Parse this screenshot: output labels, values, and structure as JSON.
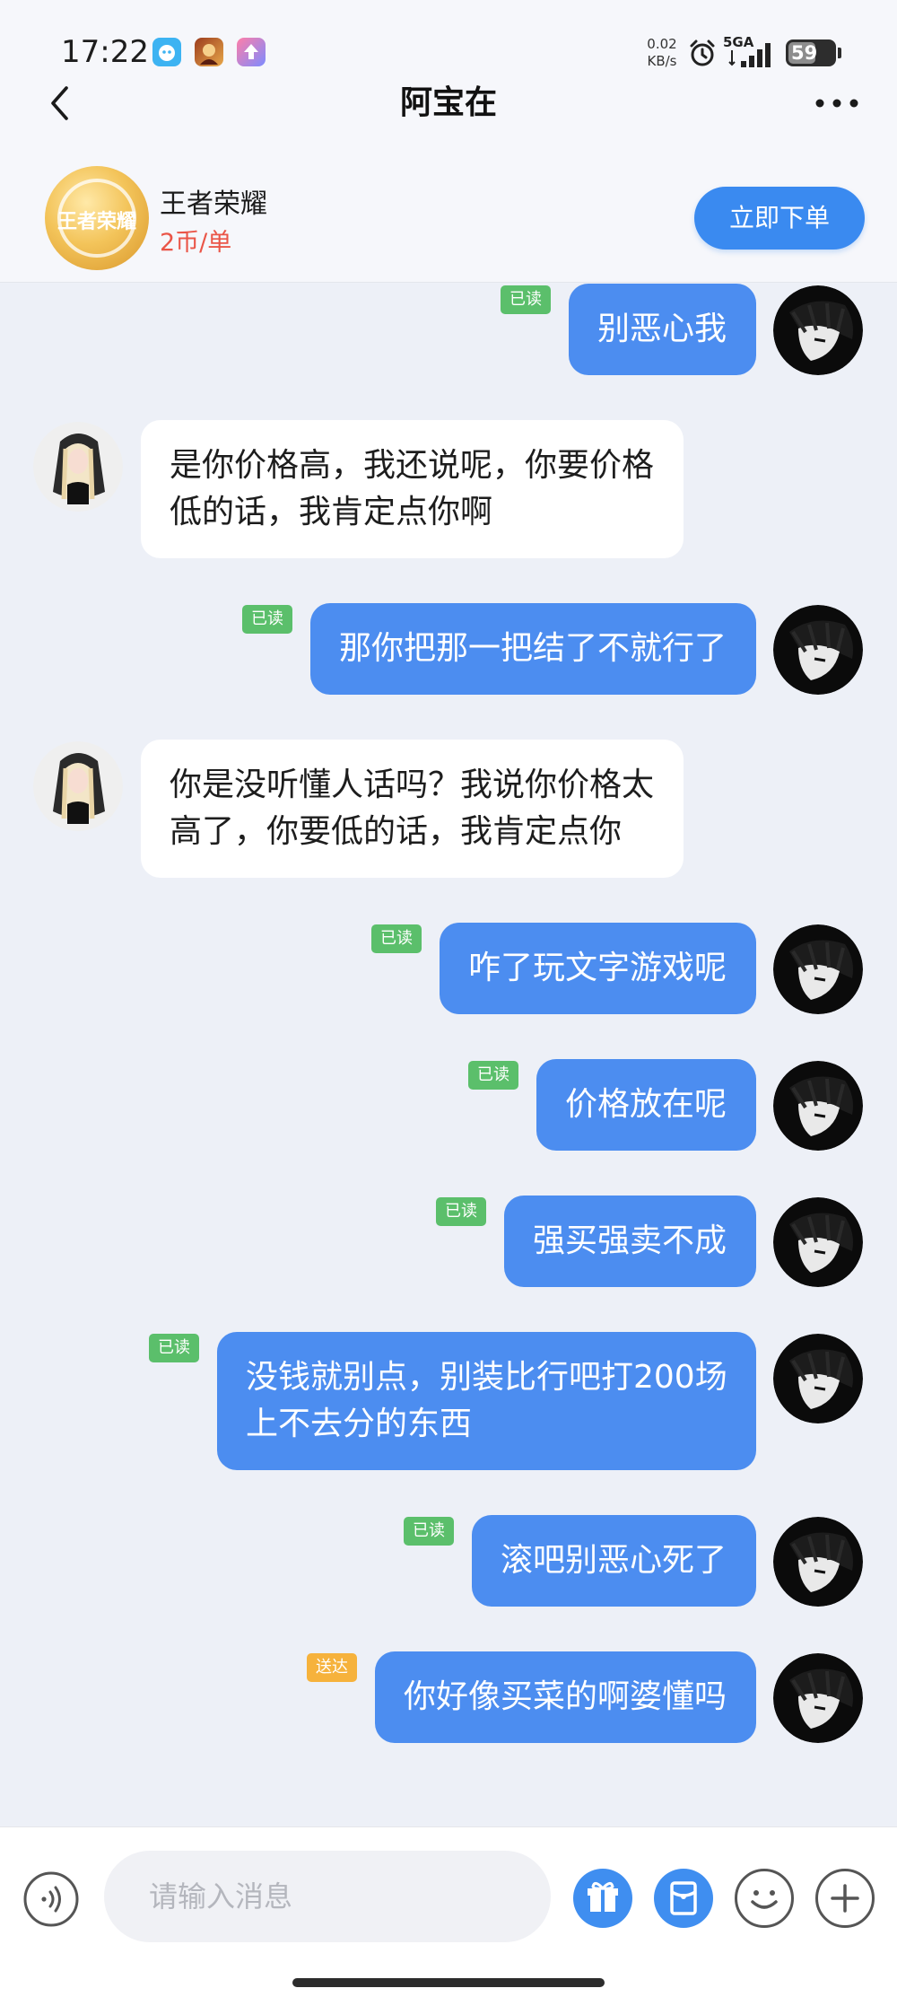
{
  "status_bar": {
    "time": "17:22",
    "net_speed_value": "0.02",
    "net_speed_unit": "KB/s",
    "signal_label": "5GA",
    "battery": "59",
    "battery_level": 0.59,
    "app_icons": [
      "assistant-app-icon",
      "game-app-icon",
      "upload-app-icon"
    ]
  },
  "nav": {
    "title": "阿宝在",
    "back_icon": "chevron-left-icon",
    "more_icon": "more-dots-icon"
  },
  "order_card": {
    "game_logo_text": "王者荣耀",
    "game_name": "王者荣耀",
    "price": "2币/单",
    "order_button": "立即下单"
  },
  "colors": {
    "outgoing_bubble": "#4c8df0",
    "incoming_bubble": "#ffffff",
    "read_badge": "#5bbf6b",
    "delivered_badge": "#f6b23c",
    "price": "#ea5547",
    "accent": "#3a8af0"
  },
  "messages": [
    {
      "side": "out",
      "lines": [
        "别恶心我"
      ],
      "receipt": "已读"
    },
    {
      "side": "in",
      "lines": [
        "是你价格高，我还说呢，你要价格",
        "低的话，我肯定点你啊"
      ]
    },
    {
      "side": "out",
      "lines": [
        "那你把那一把结了不就行了"
      ],
      "receipt": "已读"
    },
    {
      "side": "in",
      "lines": [
        "你是没听懂人话吗？我说你价格太",
        "高了，你要低的话，我肯定点你"
      ]
    },
    {
      "side": "out",
      "lines": [
        "咋了玩文字游戏呢"
      ],
      "receipt": "已读"
    },
    {
      "side": "out",
      "lines": [
        "价格放在呢"
      ],
      "receipt": "已读"
    },
    {
      "side": "out",
      "lines": [
        "强买强卖不成"
      ],
      "receipt": "已读"
    },
    {
      "side": "out",
      "lines": [
        "没钱就别点，别装比行吧打200场",
        "上不去分的东西"
      ],
      "receipt": "已读"
    },
    {
      "side": "out",
      "lines": [
        "滚吧别恶心死了"
      ],
      "receipt": "已读"
    },
    {
      "side": "out",
      "lines": [
        "你好像买菜的啊婆懂吗"
      ],
      "receipt": "送达"
    }
  ],
  "input_bar": {
    "placeholder": "请输入消息",
    "value": "",
    "icons": [
      "voice-icon",
      "gift-icon",
      "red-packet-icon",
      "emoji-icon",
      "plus-icon"
    ]
  }
}
